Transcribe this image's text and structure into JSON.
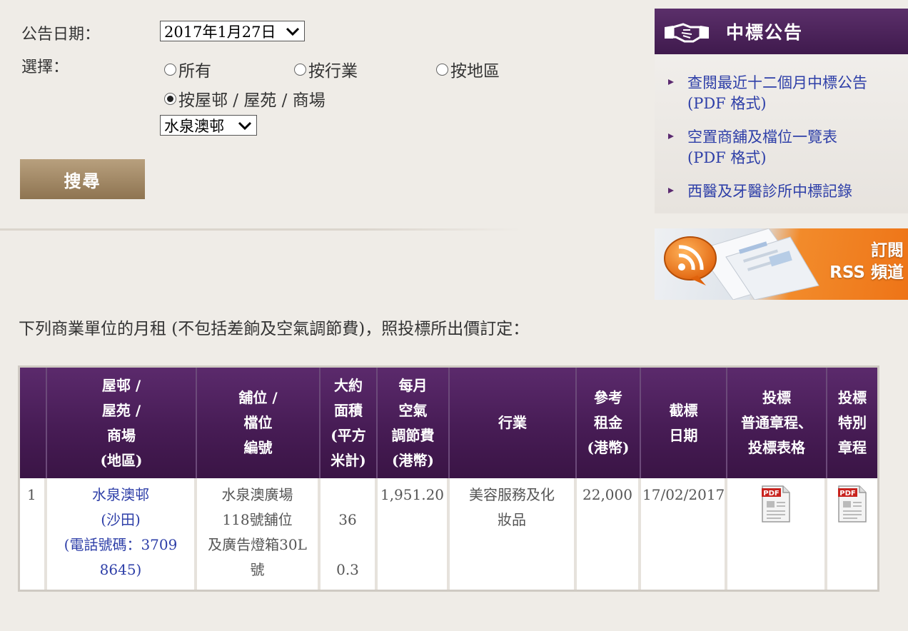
{
  "form": {
    "date_label": "公告日期：",
    "date_value": "2017年1月27日",
    "choose_label": "選擇：",
    "radios": [
      {
        "label": "所有",
        "checked": false
      },
      {
        "label": "按行業",
        "checked": false
      },
      {
        "label": "按地區",
        "checked": false
      },
      {
        "label": "按屋邨 / 屋苑 / 商場",
        "checked": true
      }
    ],
    "estate_value": "水泉澳邨",
    "search_label": "搜尋"
  },
  "sidebar": {
    "title": "中標公告",
    "links": [
      {
        "line1": "查閱最近十二個月中標公告",
        "line2": "(PDF 格式)"
      },
      {
        "line1": "空置商舖及檔位一覽表",
        "line2": "(PDF 格式)"
      },
      {
        "line1": "西醫及牙醫診所中標記錄",
        "line2": ""
      }
    ],
    "rss": {
      "line1": "訂閱",
      "line2": "RSS 頻道"
    }
  },
  "intro": "下列商業單位的月租 (不包括差餉及空氣調節費)，照投標所出價訂定：",
  "table": {
    "headers": [
      {
        "lines": [
          ""
        ]
      },
      {
        "lines": [
          "屋邨 /",
          "屋苑 /",
          "商場",
          "(地區)"
        ]
      },
      {
        "lines": [
          "舖位 /",
          "檔位",
          "編號"
        ]
      },
      {
        "lines": [
          "大約",
          "面積",
          "(平方",
          "米計)"
        ]
      },
      {
        "lines": [
          "每月",
          "空氣",
          "調節費",
          "(港幣)"
        ]
      },
      {
        "lines": [
          "行業"
        ]
      },
      {
        "lines": [
          "參考",
          "租金",
          "(港幣)"
        ]
      },
      {
        "lines": [
          "截標",
          "日期"
        ]
      },
      {
        "lines": [
          "投標",
          "普通章程、",
          "投標表格"
        ]
      },
      {
        "lines": [
          "投標",
          "特別",
          "章程"
        ]
      }
    ],
    "row": {
      "num": "1",
      "estate": [
        "水泉澳邨",
        "(沙田)",
        "(電話號碼：3709",
        "8645)"
      ],
      "shop": [
        "水泉澳廣場",
        "118號舖位",
        "及廣告燈箱30L",
        "號"
      ],
      "area": [
        "",
        "36",
        "",
        "0.3"
      ],
      "ac_fee": "1,951.20",
      "trade": [
        "美容服務及化",
        "妝品"
      ],
      "rent": "22,000",
      "close_date": "17/02/2017",
      "pdf_label": "PDF"
    }
  },
  "colors": {
    "header_purple": "#4a1d58",
    "link_blue": "#2e3fa8",
    "button_gold": "#a38b67",
    "rss_orange": "#f07d1f"
  }
}
